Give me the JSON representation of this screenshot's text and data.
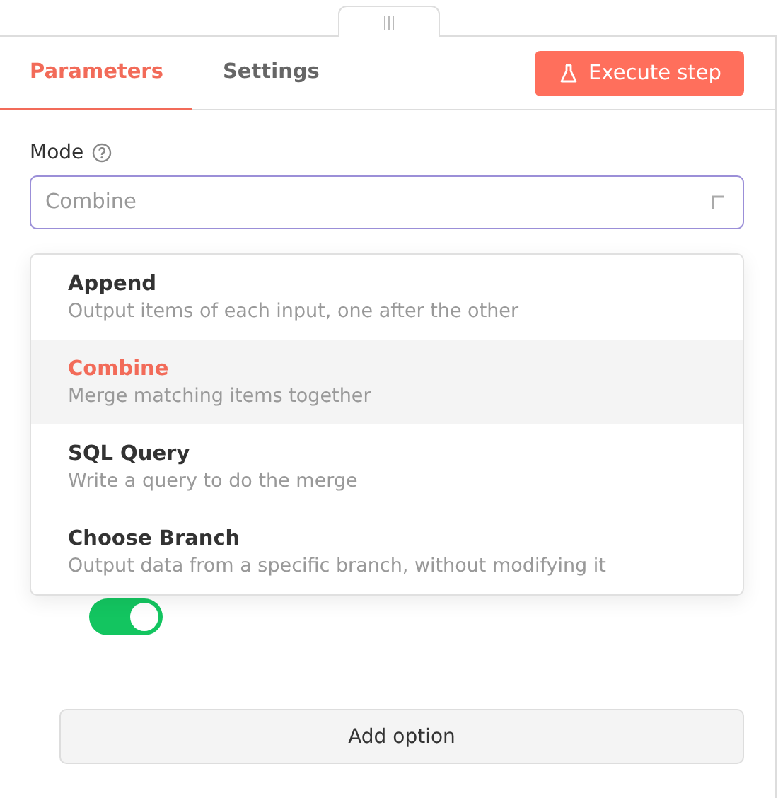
{
  "tabs": [
    {
      "label": "Parameters",
      "selected": true
    },
    {
      "label": "Settings",
      "selected": false
    }
  ],
  "execute_button": {
    "label": "Execute step"
  },
  "mode": {
    "label": "Mode",
    "field": {
      "placeholder": "Combine",
      "focused": true
    }
  },
  "dropdown": {
    "options": [
      {
        "title": "Append",
        "description": "Output items of each input, one after the other",
        "selected": false
      },
      {
        "title": "Combine",
        "description": "Merge matching items together",
        "selected": true
      },
      {
        "title": "SQL Query",
        "description": "Write a query to do the merge",
        "selected": false
      },
      {
        "title": "Choose Branch",
        "description": "Output data from a specific branch, without modifying it",
        "selected": false
      }
    ]
  },
  "toggle": {
    "on": true
  },
  "add_option_button": {
    "label": "Add option"
  }
}
